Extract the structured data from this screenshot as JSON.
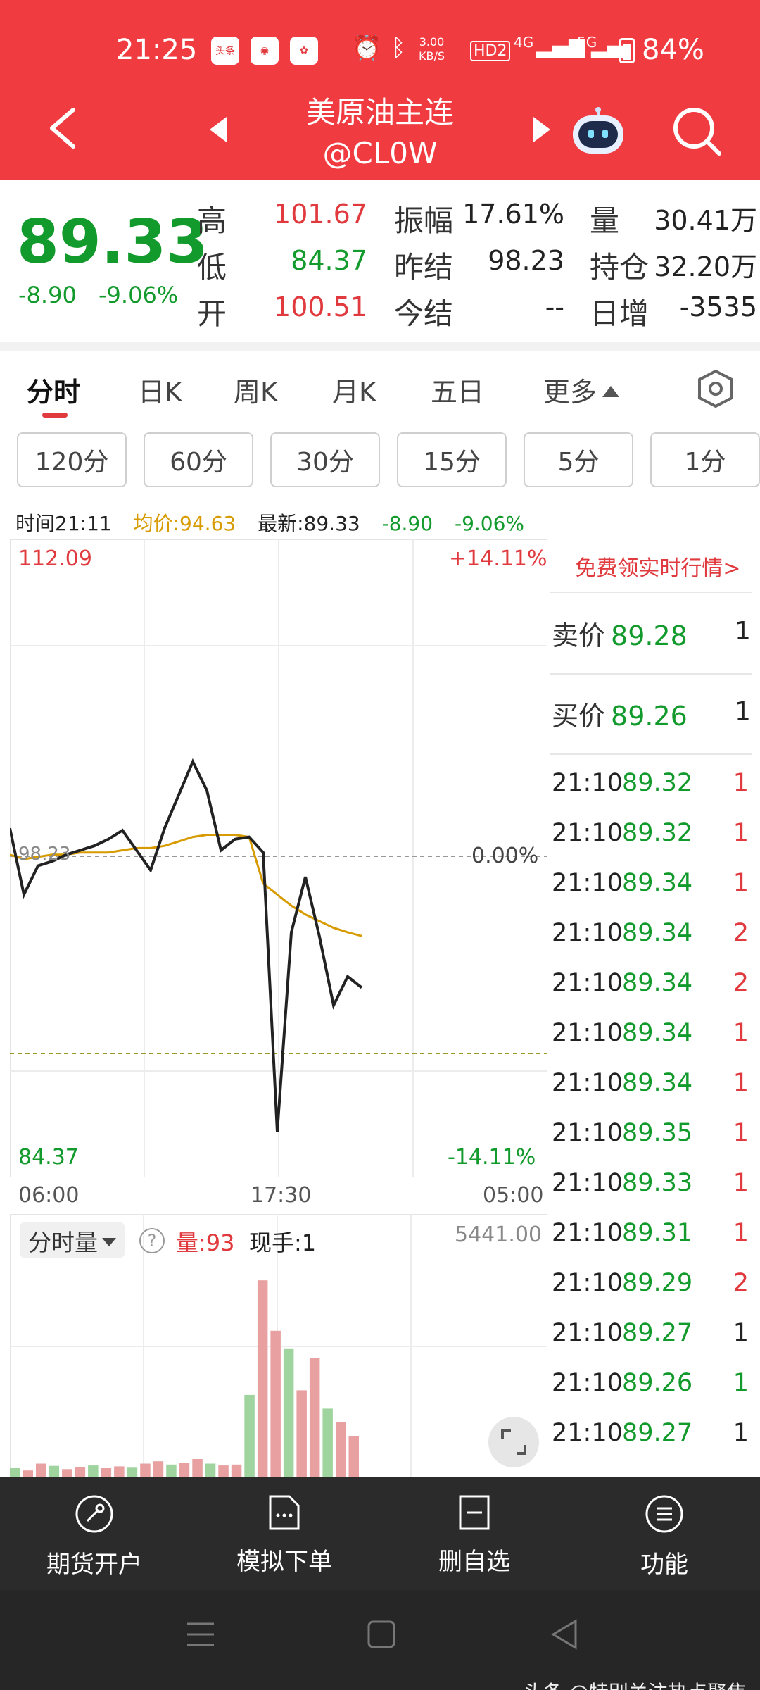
{
  "status_bar": {
    "time": "21:25",
    "app_icon_1": "头条",
    "net_speed_value": "3.00",
    "net_speed_unit": "KB/S",
    "hd": "HD2",
    "net1": "4G",
    "net2": "5G",
    "battery": "84%"
  },
  "header": {
    "title": "美原油主连",
    "subtitle": "@CL0W",
    "back_icon": "chevron-left-icon",
    "robot_icon": "robot-assistant-icon",
    "search_icon": "search-icon"
  },
  "quote": {
    "last_price": "89.33",
    "change": "-8.90",
    "change_pct": "-9.06%",
    "fields": {
      "high_label": "高",
      "high": "101.67",
      "low_label": "低",
      "low": "84.37",
      "open_label": "开",
      "open": "100.51",
      "amplitude_label": "振幅",
      "amplitude": "17.61%",
      "prev_settle_label": "昨结",
      "prev_settle": "98.23",
      "settle_label": "今结",
      "settle": "--",
      "volume_label": "量",
      "volume": "30.41万",
      "open_interest_label": "持仓",
      "open_interest": "32.20万",
      "daily_inc_label": "日增",
      "daily_inc": "-3535"
    }
  },
  "tabs": [
    "分时",
    "日K",
    "周K",
    "月K",
    "五日",
    "更多"
  ],
  "intervals": [
    "120分",
    "60分",
    "30分",
    "15分",
    "5分",
    "1分"
  ],
  "info_line": {
    "time": "时间21:11",
    "avg": "均价:94.63",
    "latest": "最新:89.33",
    "change": "-8.90",
    "change_pct": "-9.06%"
  },
  "chart": {
    "y_max": "112.09",
    "y_min": "84.37",
    "pct_max": "+14.11%",
    "pct_min": "-14.11%",
    "pct_zero": "0.00%",
    "base_label": "98.23",
    "x_labels": [
      "06:00",
      "17:30",
      "05:00"
    ]
  },
  "chart_data": {
    "type": "line",
    "ylim": [
      84.37,
      112.09
    ],
    "reference": 98.23,
    "series": [
      {
        "values": [
          99.5,
          96.5,
          97.8,
          98.0,
          98.3,
          98.5,
          98.7,
          99.0,
          99.4,
          98.5,
          97.6,
          99.5,
          101.0,
          102.5,
          101.2,
          98.5,
          99.0,
          99.1,
          98.4,
          85.8,
          94.8,
          97.3,
          94.6,
          91.5,
          92.8,
          92.3
        ]
      },
      {
        "values": [
          98.3,
          98.1,
          98.2,
          98.3,
          98.3,
          98.4,
          98.4,
          98.4,
          98.5,
          98.6,
          98.6,
          98.7,
          98.9,
          99.1,
          99.2,
          99.2,
          99.2,
          99.1,
          97.0,
          96.5,
          96.0,
          95.6,
          95.3,
          95.0,
          94.8,
          94.63
        ]
      }
    ],
    "volume": {
      "max_label": "5441.00",
      "values": [
        200,
        150,
        300,
        250,
        180,
        220,
        260,
        200,
        240,
        210,
        300,
        350,
        280,
        320,
        400,
        300,
        260,
        280,
        1800,
        4300,
        3200,
        2800,
        1900,
        2600,
        1500,
        1200,
        900
      ]
    }
  },
  "volume_panel": {
    "selector": "分时量",
    "vol_label": "量:93",
    "hand_label": "现手:1"
  },
  "ticks_panel": {
    "free_link": "免费领实时行情>",
    "ask_label": "卖价",
    "ask": "89.28",
    "ask_qty": "1",
    "bid_label": "买价",
    "bid": "89.26",
    "bid_qty": "1",
    "rows": [
      {
        "t": "21:10",
        "p": "89.32",
        "q": "1",
        "c": "red"
      },
      {
        "t": "21:10",
        "p": "89.32",
        "q": "1",
        "c": "red"
      },
      {
        "t": "21:10",
        "p": "89.34",
        "q": "1",
        "c": "red"
      },
      {
        "t": "21:10",
        "p": "89.34",
        "q": "2",
        "c": "red"
      },
      {
        "t": "21:10",
        "p": "89.34",
        "q": "2",
        "c": "red"
      },
      {
        "t": "21:10",
        "p": "89.34",
        "q": "1",
        "c": "red"
      },
      {
        "t": "21:10",
        "p": "89.34",
        "q": "1",
        "c": "red"
      },
      {
        "t": "21:10",
        "p": "89.35",
        "q": "1",
        "c": "red"
      },
      {
        "t": "21:10",
        "p": "89.33",
        "q": "1",
        "c": "red"
      },
      {
        "t": "21:10",
        "p": "89.31",
        "q": "1",
        "c": "red"
      },
      {
        "t": "21:10",
        "p": "89.29",
        "q": "2",
        "c": "red"
      },
      {
        "t": "21:10",
        "p": "89.27",
        "q": "1",
        "c": "dark"
      },
      {
        "t": "21:10",
        "p": "89.26",
        "q": "1",
        "c": "green"
      },
      {
        "t": "21:10",
        "p": "89.27",
        "q": "1",
        "c": "dark"
      }
    ]
  },
  "bottom_nav": [
    "期货开户",
    "模拟下单",
    "删自选",
    "功能"
  ],
  "watermark": "头条 @特别关注热点聚焦"
}
